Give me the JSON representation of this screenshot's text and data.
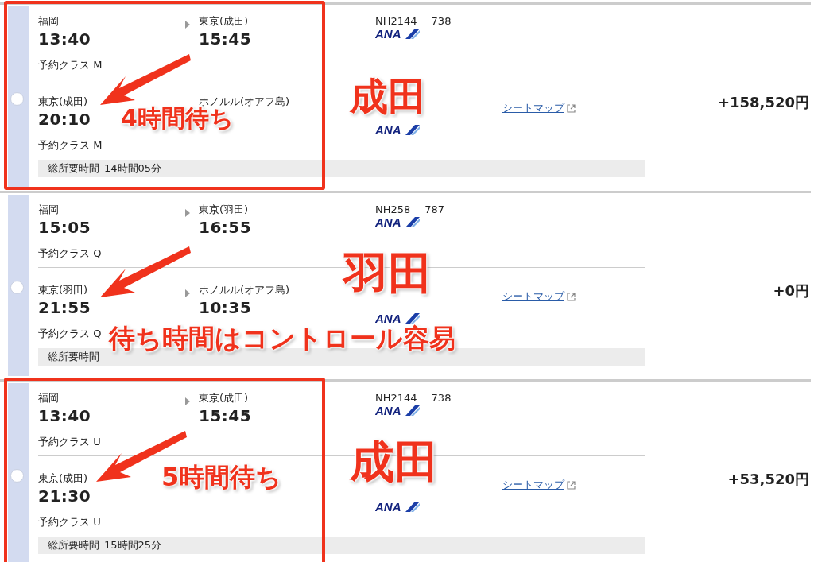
{
  "options": [
    {
      "selected": false,
      "price": "+158,520円",
      "duration": {
        "label": "総所要時間",
        "value": "14時間05分"
      },
      "segments": [
        {
          "from": "福岡",
          "dep_time": "13:40",
          "to": "東京(成田)",
          "arr_time": "15:45",
          "booking_class": "予約クラス M",
          "flight_no": "NH2144",
          "aircraft": "738",
          "airline": "ANA"
        },
        {
          "from": "東京(成田)",
          "dep_time": "20:10",
          "to": "ホノルル(オアフ島)",
          "booking_class": "予約クラス M",
          "airline": "ANA",
          "seat_map": "シートマップ"
        }
      ],
      "annotation": {
        "boxed": true,
        "wait_note": "4時間待ち",
        "airport_note": "成田"
      }
    },
    {
      "selected": false,
      "price": "+0円",
      "duration": {
        "label": "総所要時間"
      },
      "segments": [
        {
          "from": "福岡",
          "dep_time": "15:05",
          "to": "東京(羽田)",
          "arr_time": "16:55",
          "booking_class": "予約クラス Q",
          "flight_no": "NH258",
          "aircraft": "787",
          "airline": "ANA"
        },
        {
          "from": "東京(羽田)",
          "dep_time": "21:55",
          "to": "ホノルル(オアフ島)",
          "arr_time": "10:35",
          "booking_class": "予約クラス Q",
          "airline": "ANA",
          "seat_map": "シートマップ"
        }
      ],
      "annotation": {
        "boxed": false,
        "banner_note": "待ち時間はコントロール容易",
        "airport_note": "羽田"
      }
    },
    {
      "selected": false,
      "price": "+53,520円",
      "duration": {
        "label": "総所要時間",
        "value": "15時間25分"
      },
      "segments": [
        {
          "from": "福岡",
          "dep_time": "13:40",
          "to": "東京(成田)",
          "arr_time": "15:45",
          "booking_class": "予約クラス U",
          "flight_no": "NH2144",
          "aircraft": "738",
          "airline": "ANA"
        },
        {
          "from": "東京(成田)",
          "dep_time": "21:30",
          "booking_class": "予約クラス U",
          "airline": "ANA",
          "seat_map": "シートマップ"
        }
      ],
      "annotation": {
        "boxed": true,
        "wait_note": "5時間待ち",
        "airport_note": "成田"
      }
    }
  ]
}
